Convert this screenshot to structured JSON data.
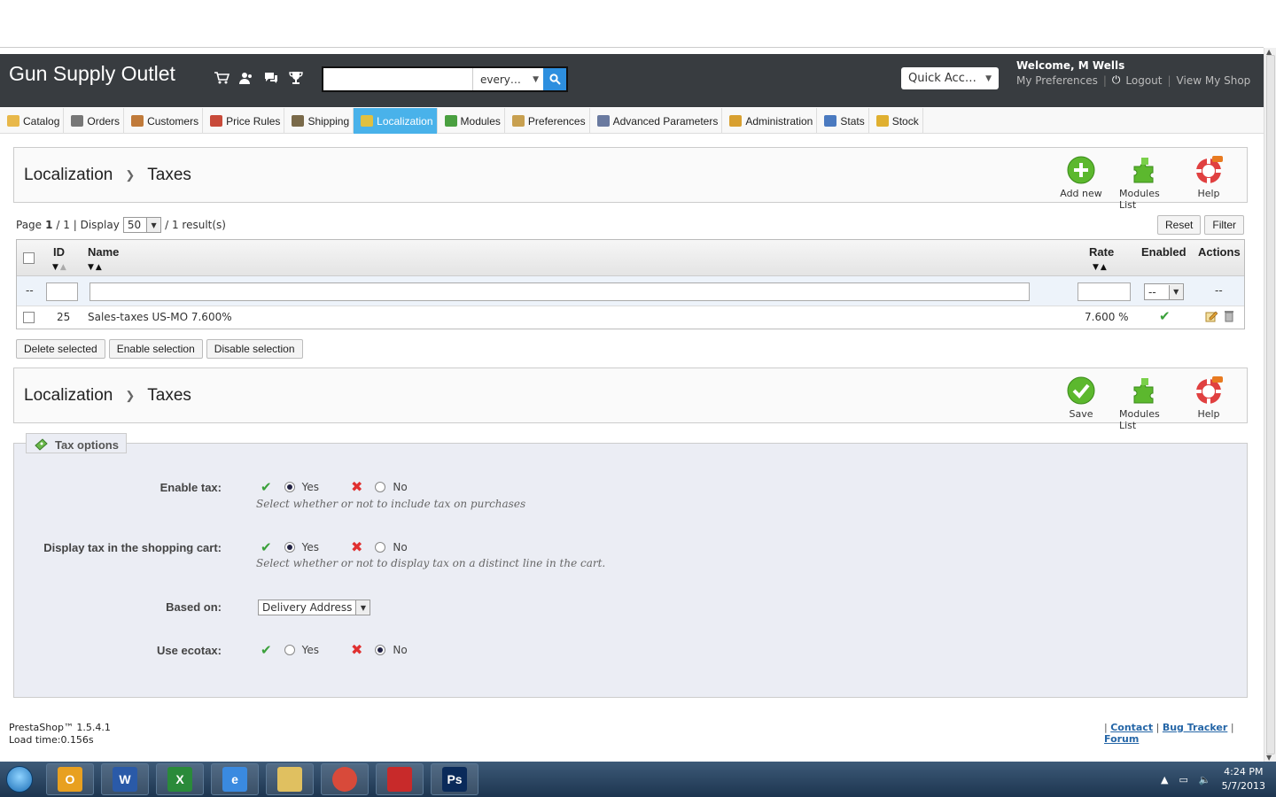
{
  "header": {
    "shop_name": "Gun Supply Outlet",
    "search_placeholder": "",
    "search_scope": "every…",
    "quick_access": "Quick Acc…",
    "welcome_prefix": "Welcome, ",
    "user_name": "M Wells",
    "my_preferences": "My Preferences",
    "logout": "Logout",
    "view_shop": "View My Shop"
  },
  "nav": {
    "tabs": [
      {
        "label": "Catalog",
        "icon": "folder-icon",
        "color": "#e8b84a"
      },
      {
        "label": "Orders",
        "icon": "cart-icon",
        "color": "#777777"
      },
      {
        "label": "Customers",
        "icon": "user-icon",
        "color": "#c07a3a"
      },
      {
        "label": "Price Rules",
        "icon": "pricetag-icon",
        "color": "#c84a3a"
      },
      {
        "label": "Shipping",
        "icon": "truck-icon",
        "color": "#7a6a4a"
      },
      {
        "label": "Localization",
        "icon": "globe-icon",
        "color": "#e0c040"
      },
      {
        "label": "Modules",
        "icon": "puzzle-icon",
        "color": "#4aa040"
      },
      {
        "label": "Preferences",
        "icon": "preferences-icon",
        "color": "#c8a050"
      },
      {
        "label": "Advanced Parameters",
        "icon": "wrench-icon",
        "color": "#6a7aa0"
      },
      {
        "label": "Administration",
        "icon": "key-icon",
        "color": "#d8a030"
      },
      {
        "label": "Stats",
        "icon": "chart-icon",
        "color": "#4a7ac0"
      },
      {
        "label": "Stock",
        "icon": "stock-icon",
        "color": "#e0b030"
      }
    ],
    "active": "Localization"
  },
  "toolbar1": {
    "crumb1": "Localization",
    "crumb2": "Taxes",
    "add_new": "Add new",
    "modules_list": "Modules List",
    "help": "Help"
  },
  "list": {
    "page_label": "Page",
    "page_current": "1",
    "page_total": "/ 1 | Display",
    "per_page": "50",
    "results": "/ 1 result(s)",
    "reset": "Reset",
    "filter": "Filter",
    "columns": {
      "id": "ID",
      "name": "Name",
      "rate": "Rate",
      "enabled": "Enabled",
      "actions": "Actions"
    },
    "filter_row": {
      "dash": "--",
      "enabled_select": "--",
      "actions_dash": "--"
    },
    "rows": [
      {
        "id": "25",
        "name": "Sales-taxes US-MO 7.600%",
        "rate": "7.600 %",
        "enabled": true
      }
    ],
    "bulk": {
      "delete": "Delete selected",
      "enable": "Enable selection",
      "disable": "Disable selection"
    }
  },
  "toolbar2": {
    "crumb1": "Localization",
    "crumb2": "Taxes",
    "save": "Save",
    "modules_list": "Modules List",
    "help": "Help"
  },
  "tax_options": {
    "legend": "Tax options",
    "enable_tax": {
      "label": "Enable tax:",
      "yes": "Yes",
      "no": "No",
      "value": "yes",
      "hint": "Select whether or not to include tax on purchases"
    },
    "display_tax": {
      "label": "Display tax in the shopping cart:",
      "yes": "Yes",
      "no": "No",
      "value": "yes",
      "hint": "Select whether or not to display tax on a distinct line in the cart."
    },
    "based_on": {
      "label": "Based on:",
      "value": "Delivery Address"
    },
    "ecotax": {
      "label": "Use ecotax:",
      "yes": "Yes",
      "no": "No",
      "value": "no"
    }
  },
  "footer": {
    "version": "PrestaShop™ 1.5.4.1",
    "load_time": "Load time:0.156s",
    "contact": "Contact",
    "bug_tracker": "Bug Tracker",
    "forum": "Forum"
  },
  "taskbar": {
    "time": "4:24 PM",
    "date": "5/7/2013",
    "apps": [
      {
        "name": "outlook",
        "letter": "O",
        "color": "#e8a020"
      },
      {
        "name": "word",
        "letter": "W",
        "color": "#2a5aa8"
      },
      {
        "name": "excel",
        "letter": "X",
        "color": "#2a8a3a"
      },
      {
        "name": "ie",
        "letter": "e",
        "color": "#3a8ae0"
      },
      {
        "name": "explorer",
        "letter": "",
        "color": "#e0c060"
      },
      {
        "name": "chrome",
        "letter": "",
        "color": "#d84a3a"
      },
      {
        "name": "acrobat",
        "letter": "",
        "color": "#c82a2a"
      },
      {
        "name": "photoshop",
        "letter": "Ps",
        "color": "#0a2a5a"
      }
    ]
  }
}
